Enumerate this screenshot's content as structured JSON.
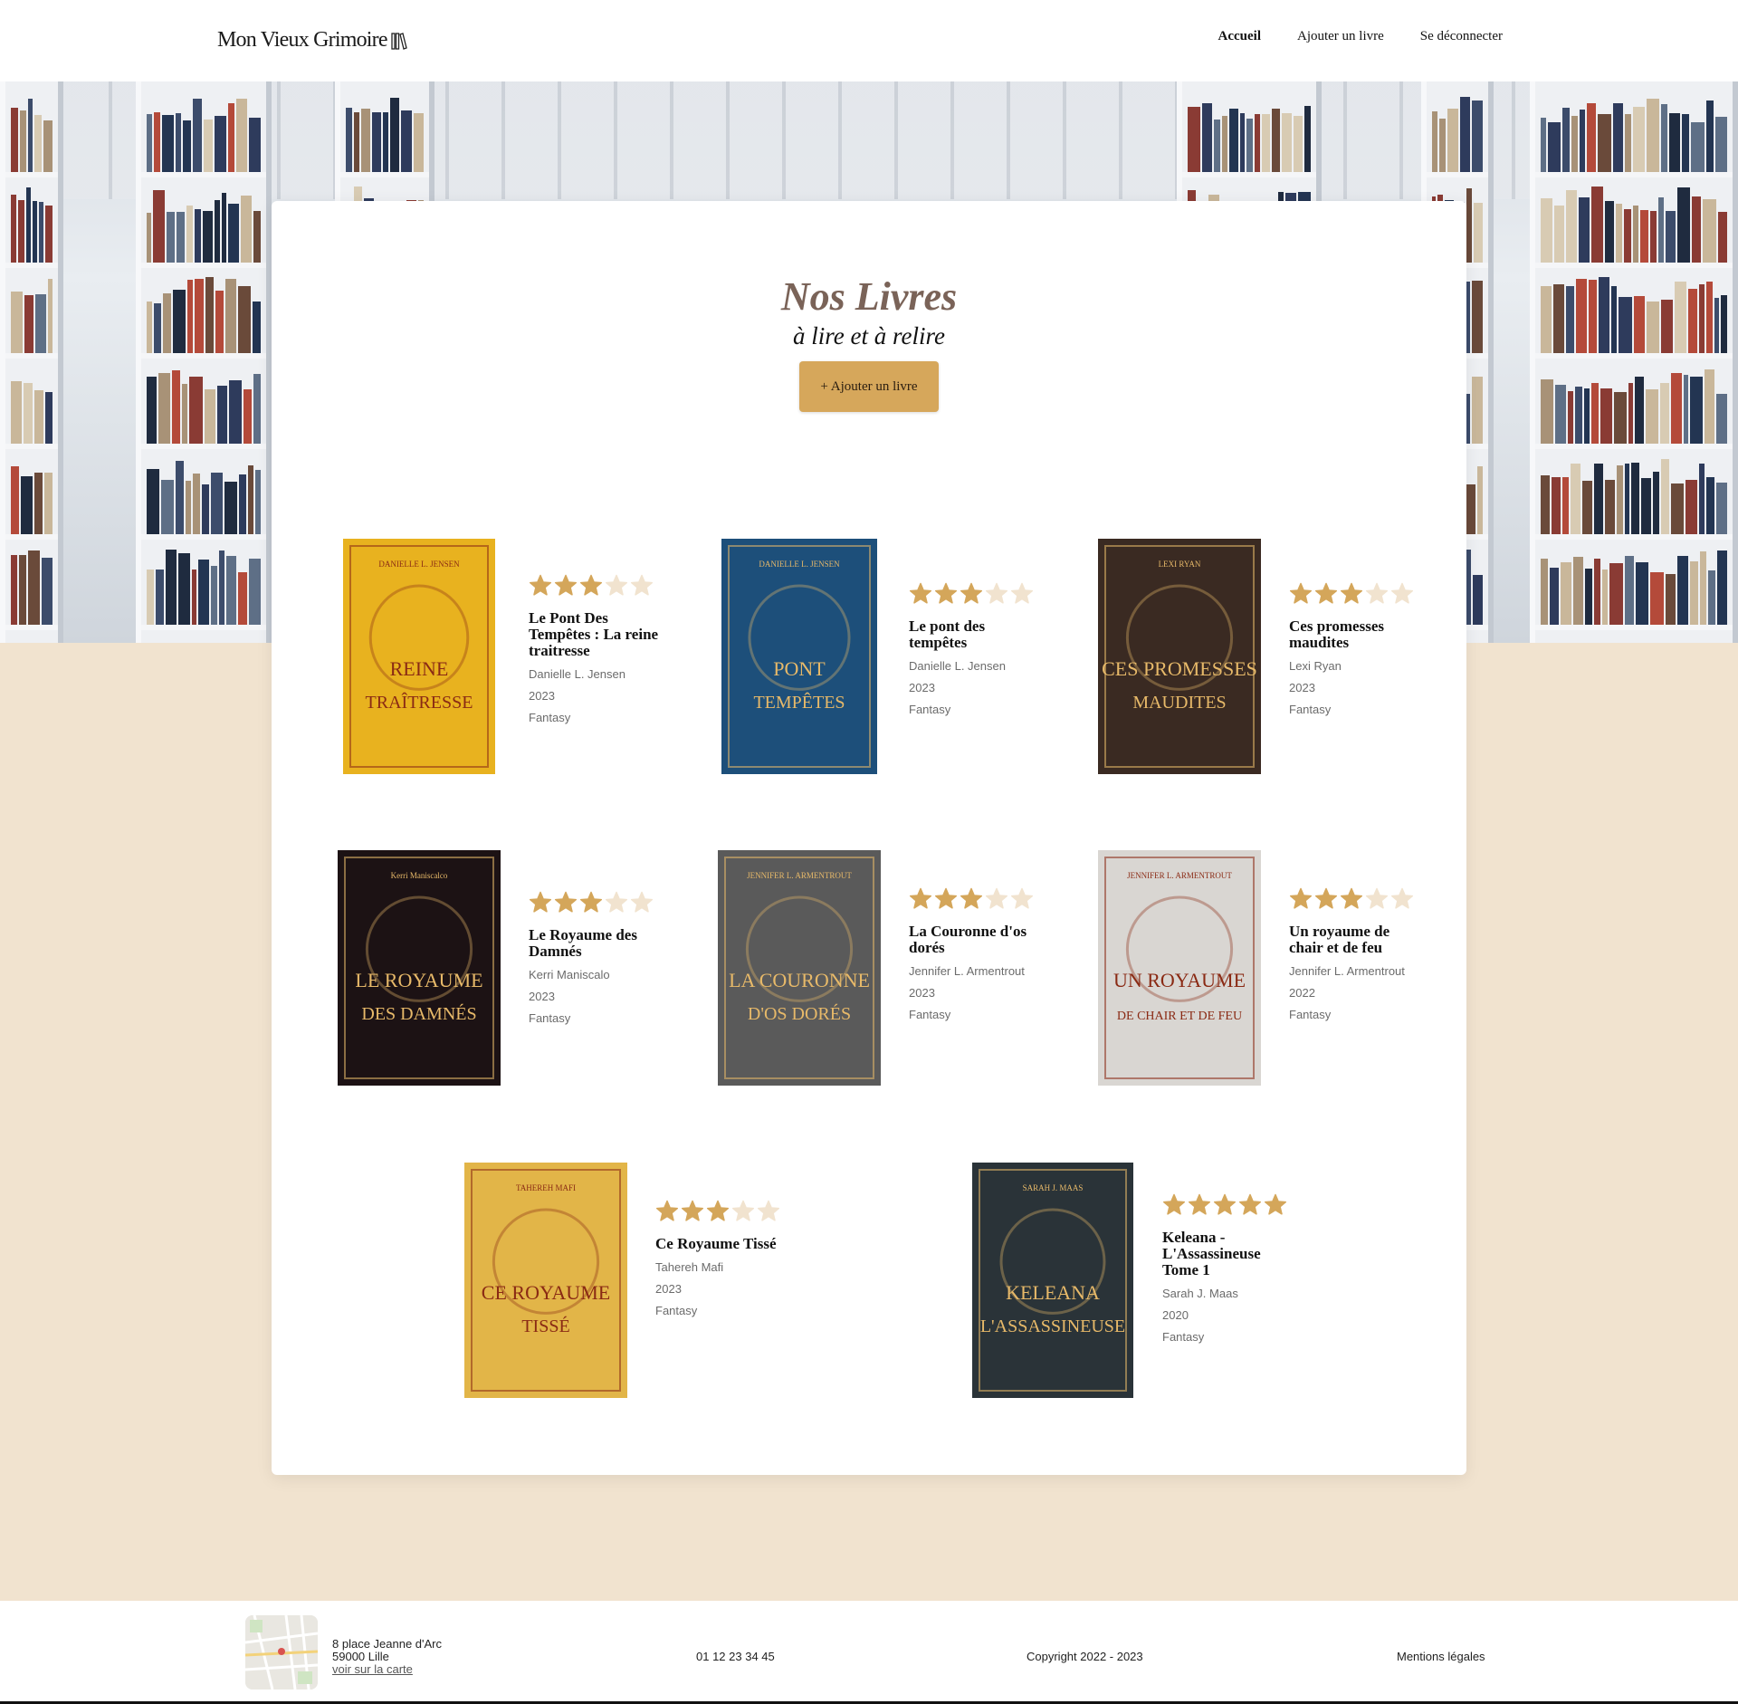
{
  "header": {
    "logo_text": "Mon Vieux Grimoire",
    "nav": [
      {
        "label": "Accueil"
      },
      {
        "label": "Ajouter un livre"
      },
      {
        "label": "Se déconnecter"
      }
    ]
  },
  "main": {
    "title": "Nos Livres",
    "subtitle": "à lire et à relire",
    "add_button": "+ Ajouter un livre"
  },
  "books": [
    {
      "title": "Le Pont Des Tempêtes : La reine traitresse",
      "author": "Danielle L. Jensen",
      "year": "2023",
      "genre": "Fantasy",
      "rating": 3,
      "cover_text": [
        "DANIELLE L. JENSEN",
        "REINE",
        "TRAÎTRESSE"
      ],
      "cover_color": "#e8b21f"
    },
    {
      "title": "Le pont des tempêtes",
      "author": "Danielle L. Jensen",
      "year": "2023",
      "genre": "Fantasy",
      "rating": 3,
      "cover_text": [
        "DANIELLE L. JENSEN",
        "PONT",
        "TEMPÊTES"
      ],
      "cover_color": "#1d4f7a"
    },
    {
      "title": "Ces promesses maudites",
      "author": "Lexi Ryan",
      "year": "2023",
      "genre": "Fantasy",
      "rating": 3,
      "cover_text": [
        "LEXI RYAN",
        "CES PROMESSES",
        "MAUDITES"
      ],
      "cover_color": "#3a2a22"
    },
    {
      "title": "Le Royaume des Damnés",
      "author": "Kerri Maniscalo",
      "year": "2023",
      "genre": "Fantasy",
      "rating": 3,
      "cover_text": [
        "Kerri Maniscalco",
        "LE ROYAUME",
        "DES DAMNÉS"
      ],
      "cover_color": "#1c1214"
    },
    {
      "title": "La Couronne d'os dorés",
      "author": "Jennifer L. Armentrout",
      "year": "2023",
      "genre": "Fantasy",
      "rating": 3,
      "cover_text": [
        "JENNIFER L. ARMENTROUT",
        "LA COURONNE",
        "D'OS DORÉS"
      ],
      "cover_color": "#5a5a5a"
    },
    {
      "title": "Un royaume de chair et de feu",
      "author": "Jennifer L. Armentrout",
      "year": "2022",
      "genre": "Fantasy",
      "rating": 3,
      "cover_text": [
        "JENNIFER L. ARMENTROUT",
        "UN ROYAUME",
        "DE CHAIR ET DE FEU"
      ],
      "cover_color": "#d9d6d2"
    },
    {
      "title": "Ce Royaume Tissé",
      "author": "Tahereh Mafi",
      "year": "2023",
      "genre": "Fantasy",
      "rating": 3,
      "cover_text": [
        "TAHEREH MAFI",
        "CE ROYAUME",
        "TISSÉ"
      ],
      "cover_color": "#e2b548"
    },
    {
      "title": "Keleana - L'Assassineuse Tome 1",
      "author": "Sarah J. Maas",
      "year": "2020",
      "genre": "Fantasy",
      "rating": 5,
      "cover_text": [
        "SARAH J. MAAS",
        "KELEANA",
        "L'ASSASSINEUSE"
      ],
      "cover_color": "#2a3338"
    }
  ],
  "footer": {
    "address_line1": "8 place Jeanne d'Arc",
    "address_line2": "59000 Lille",
    "map_link": "voir sur la carte",
    "phone": "01 12 23 34 45",
    "copyright": "Copyright 2022 - 2023",
    "legal": "Mentions légales"
  },
  "colors": {
    "accent": "#d6a75b",
    "star_filled": "#d4a65a",
    "star_empty": "#f1e3cf",
    "page_bg": "#f1e3cf",
    "title": "#7a6358"
  },
  "icons": {
    "logo": "books-icon",
    "star": "star-icon"
  }
}
